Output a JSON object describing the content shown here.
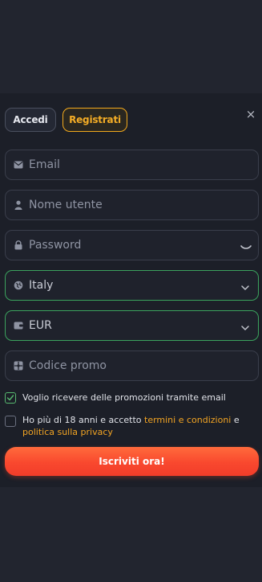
{
  "tabs": {
    "login": "Accedi",
    "register": "Registrati"
  },
  "close": {
    "glyph": "×"
  },
  "fields": {
    "email": {
      "placeholder": "Email"
    },
    "username": {
      "placeholder": "Nome utente"
    },
    "password": {
      "placeholder": "Password"
    },
    "country": {
      "value": "Italy"
    },
    "currency": {
      "value": "EUR"
    },
    "promo": {
      "placeholder": "Codice promo"
    }
  },
  "checkboxes": {
    "promotions": {
      "label": "Voglio ricevere delle promozioni tramite email",
      "checked": true
    },
    "terms": {
      "prefix": "Ho più di 18 anni e accetto ",
      "terms_link": "termini e condizioni",
      "middle": " e",
      "privacy_link": "politica sulla privacy",
      "checked": false
    }
  },
  "cta": {
    "label": "Iscriviti ora!"
  },
  "colors": {
    "accent": "#f2a91c",
    "valid": "#3ba25d",
    "cta": "#f9482e"
  }
}
